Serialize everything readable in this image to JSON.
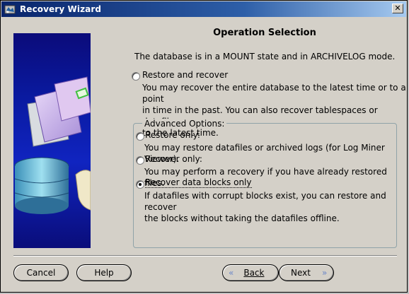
{
  "window": {
    "title": "Recovery Wizard",
    "close_glyph": "✕"
  },
  "heading": "Operation Selection",
  "intro": "The database is in a MOUNT state and in ARCHIVELOG mode.",
  "options": {
    "restore_recover": {
      "label": "Restore and recover",
      "desc_lines": [
        "You may recover the entire database to the latest time or to a point",
        "in time in the past. You can also recover tablespaces or datafiles",
        "to the latest time."
      ],
      "selected": false
    }
  },
  "advanced": {
    "title": "Advanced Options:",
    "restore_only": {
      "label": "Restore only:",
      "desc": "You may restore datafiles or archived logs (for Log Miner Viewer).",
      "selected": false
    },
    "recover_only": {
      "label": "Recover only:",
      "desc": "You may perform a recovery if you have already restored files.",
      "selected": false
    },
    "recover_blocks": {
      "label": "Recover data blocks only",
      "desc_lines": [
        "If datafiles with corrupt blocks exist, you can restore and recover",
        "the blocks without taking the datafiles offline."
      ],
      "selected": true
    }
  },
  "buttons": {
    "cancel": "Cancel",
    "help": "Help",
    "back": "Back",
    "next": "Next",
    "back_arrow": "«",
    "next_arrow": "»"
  },
  "colors": {
    "title_bar": "#08246b",
    "art_background": "#0a1aa0",
    "window_bg": "#d4d0c8"
  }
}
